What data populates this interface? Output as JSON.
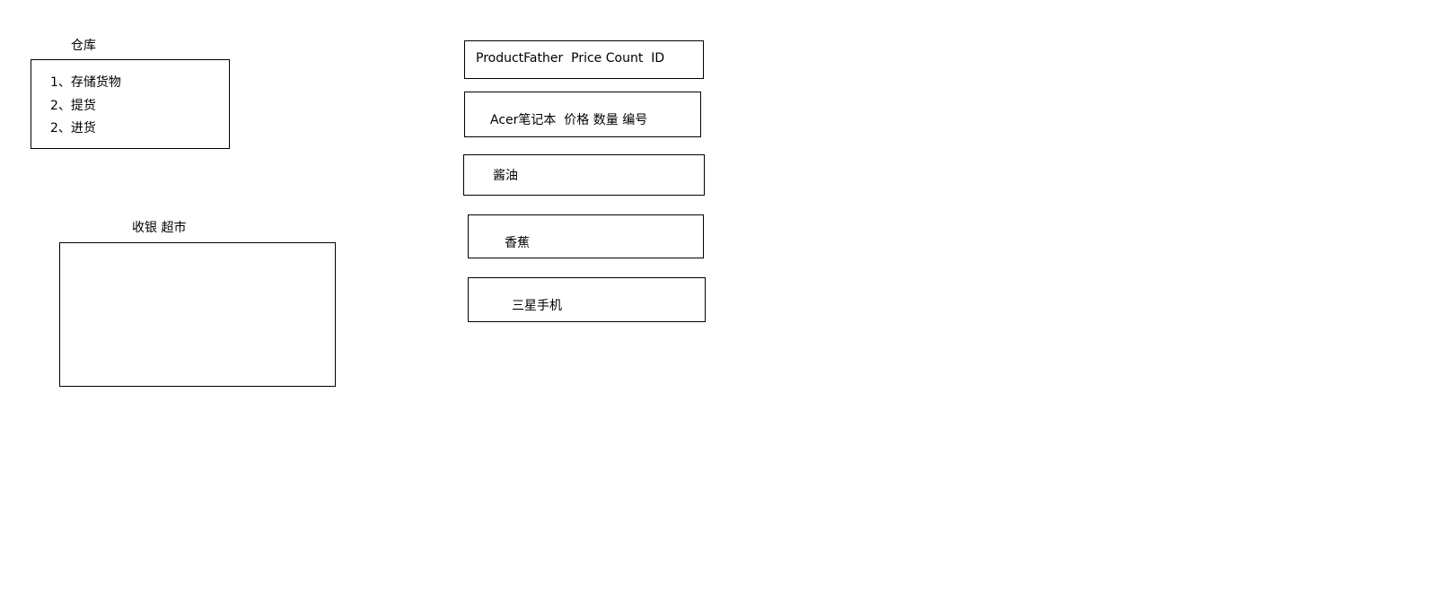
{
  "warehouse": {
    "title": "仓库",
    "items": [
      "1、存储货物",
      "2、提货",
      "2、进货"
    ]
  },
  "checkout": {
    "title": "收银 超市"
  },
  "products": [
    "ProductFather  Price Count  ID",
    "Acer笔记本  价格 数量 编号",
    "酱油",
    "香蕉",
    "三星手机"
  ]
}
